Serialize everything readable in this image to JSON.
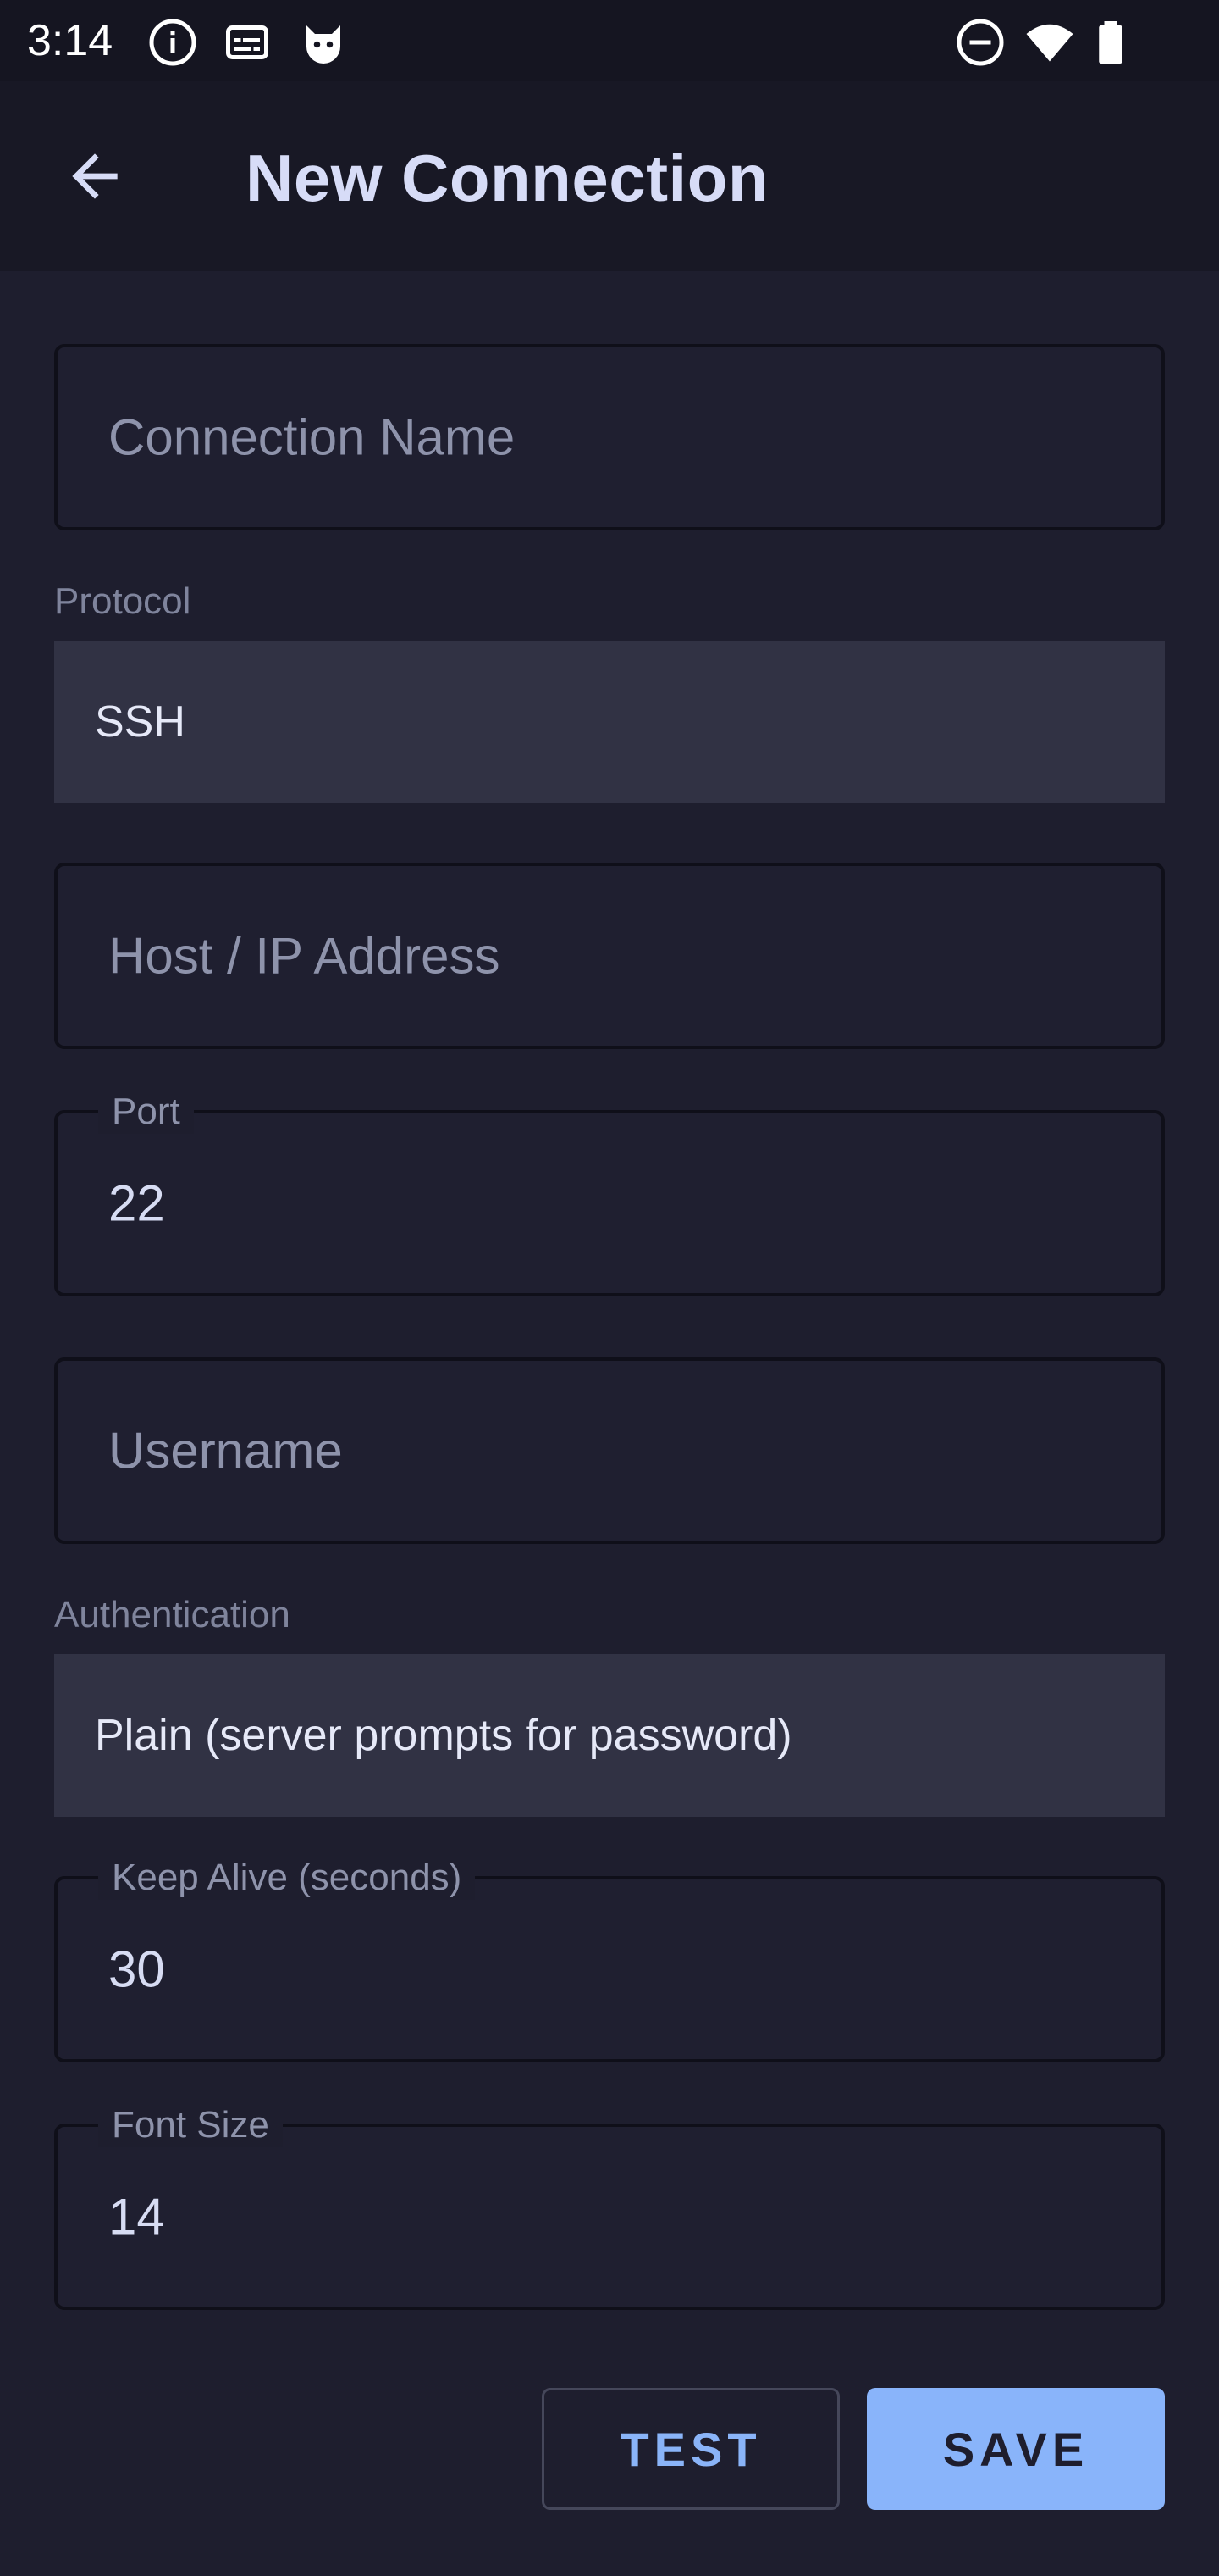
{
  "status_bar": {
    "time": "3:14",
    "left_icons": [
      "info-icon",
      "subtitles-icon",
      "cat-icon"
    ],
    "right_icons": [
      "do-not-disturb-icon",
      "wifi-icon",
      "battery-icon"
    ]
  },
  "app_bar": {
    "title": "New Connection",
    "back_icon": "arrow-back-icon"
  },
  "form": {
    "connection_name": {
      "placeholder": "Connection Name",
      "value": ""
    },
    "protocol": {
      "label": "Protocol",
      "selected": "SSH"
    },
    "host": {
      "placeholder": "Host / IP Address",
      "value": ""
    },
    "port": {
      "label": "Port",
      "value": "22"
    },
    "username": {
      "placeholder": "Username",
      "value": ""
    },
    "authentication": {
      "label": "Authentication",
      "selected": "Plain (server prompts for password)"
    },
    "keep_alive": {
      "label": "Keep Alive (seconds)",
      "value": "30"
    },
    "font_size": {
      "label": "Font Size",
      "value": "14"
    }
  },
  "actions": {
    "test_label": "TEST",
    "save_label": "SAVE"
  },
  "colors": {
    "background": "#1e1e2e",
    "app_bar": "#181825",
    "status_bar": "#151521",
    "select_fill": "#313244",
    "accent": "#89b4fa",
    "text_primary": "#d7dcf3",
    "text_hint": "#8e93ab"
  }
}
